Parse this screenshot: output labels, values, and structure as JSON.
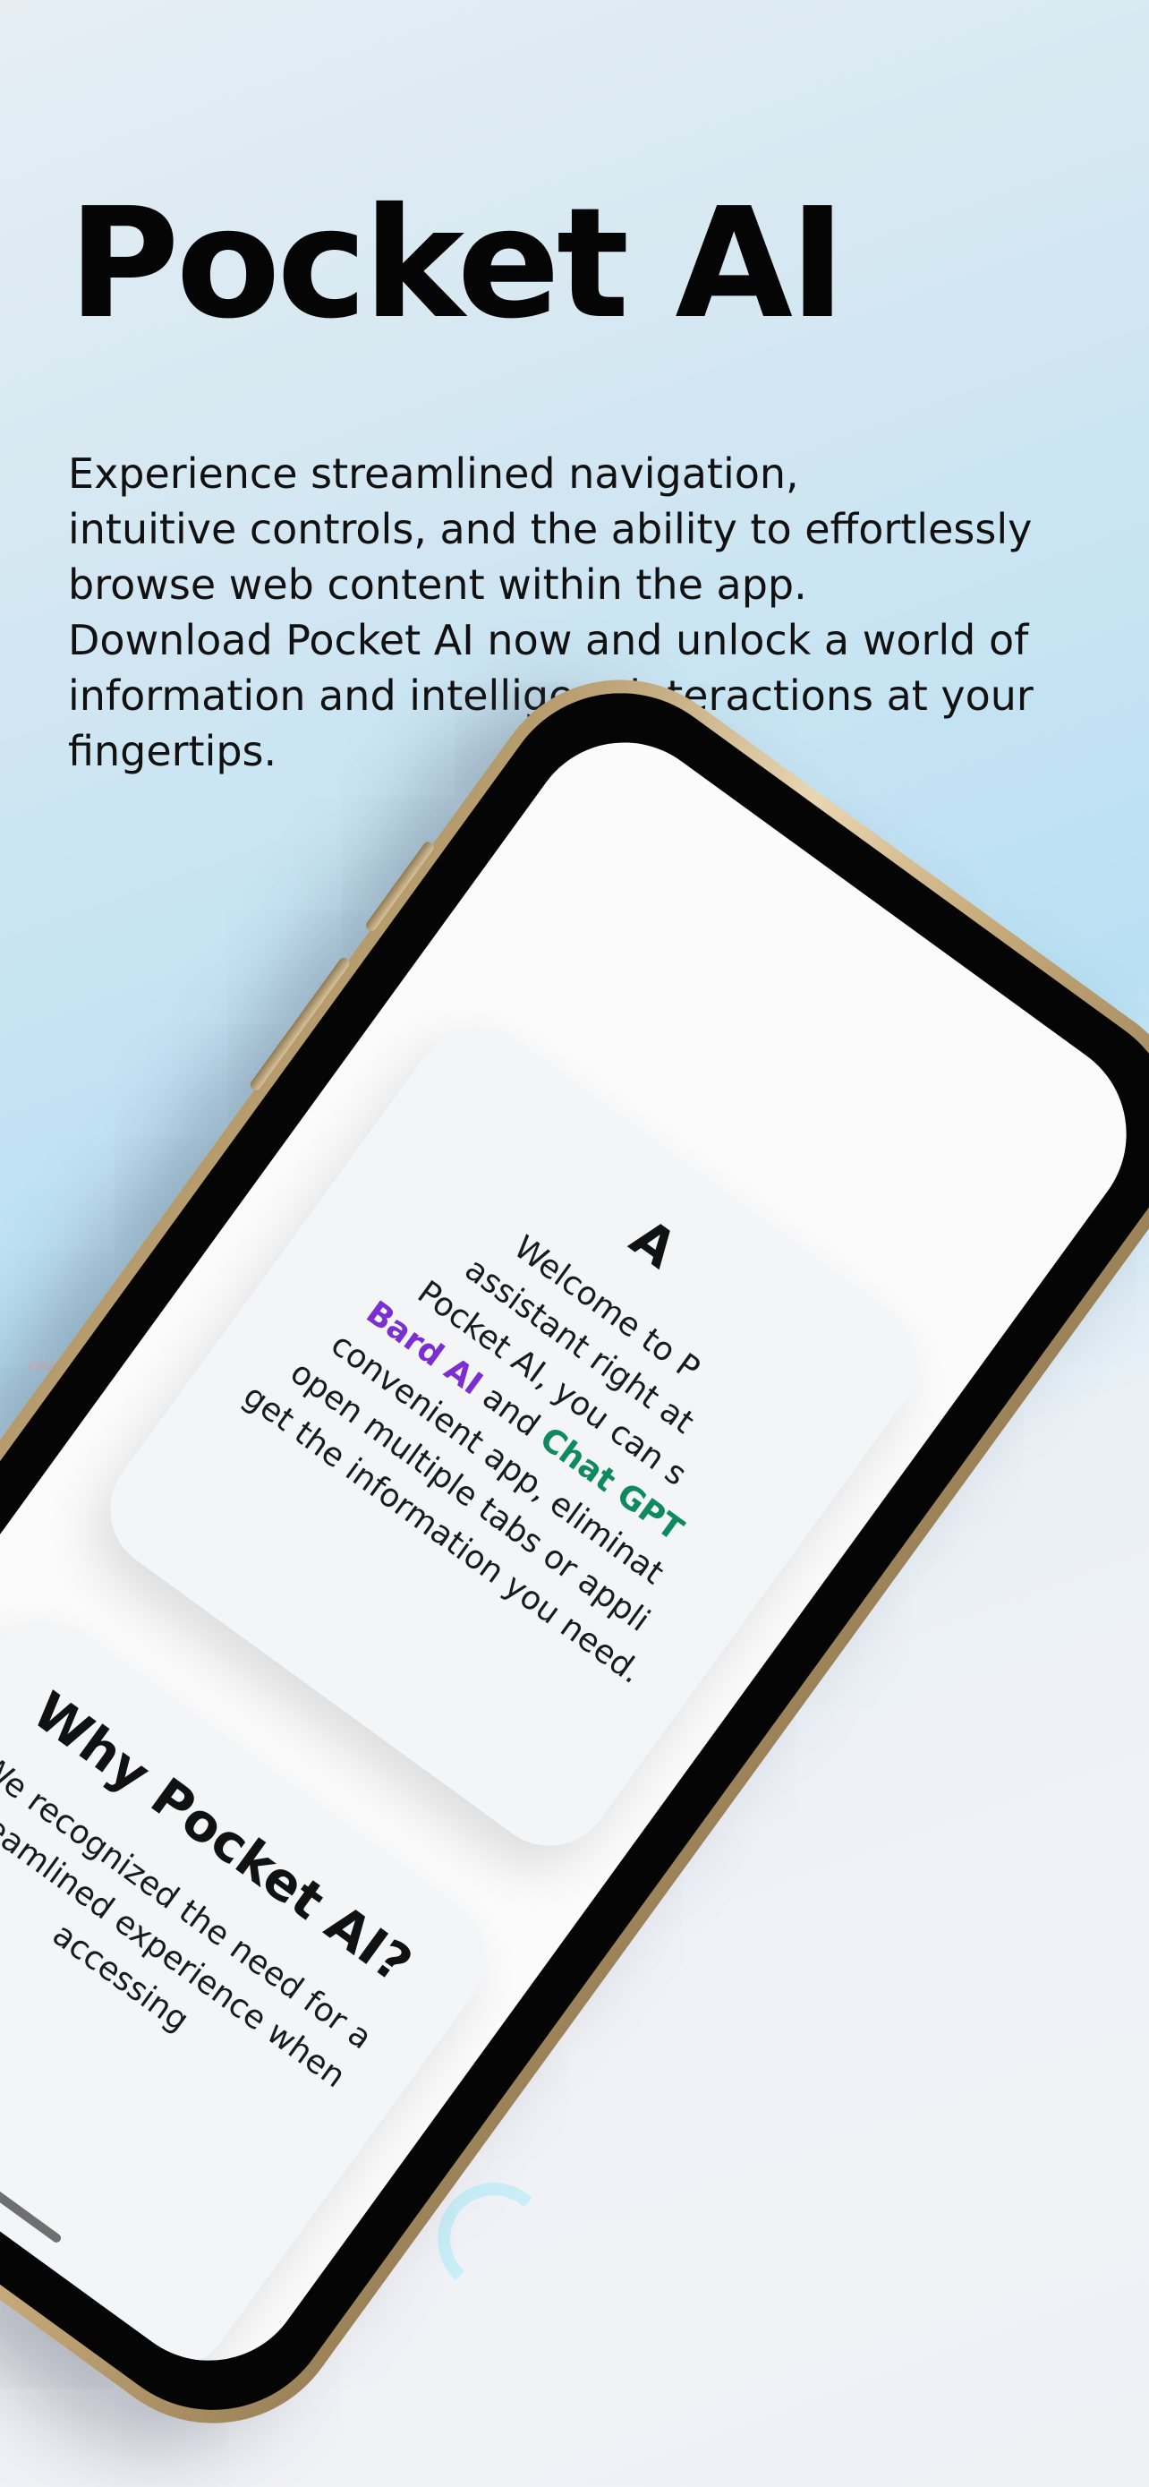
{
  "headline": "Pocket AI",
  "description": "Experience streamlined navigation,\nintuitive controls, and the ability to effortlessly\nbrowse web content within the app.\nDownload Pocket AI now and unlock a world of\ninformation and intelligent interactions at your\nfingertips.",
  "phone_screen": {
    "card_1": {
      "title": "A",
      "text_lines": [
        "Welcome to P",
        "assistant right at",
        "Pocket AI, you can s"
      ],
      "brand_1": "Bard AI",
      "and_word": " and ",
      "brand_2": "Chat GPT",
      "text_lines_after": [
        "convenient app, eliminat",
        "open multiple tabs or appli",
        "get the information you need."
      ]
    },
    "card_2": {
      "title": "Why Pocket AI?",
      "text_lines": [
        "We recognized the need for a",
        "streamlined experience when accessing"
      ]
    }
  },
  "colors": {
    "bard_ai": "#7b2fd1",
    "chat_gpt": "#0e8a5e",
    "phone_frame": "#c9ac7c"
  }
}
